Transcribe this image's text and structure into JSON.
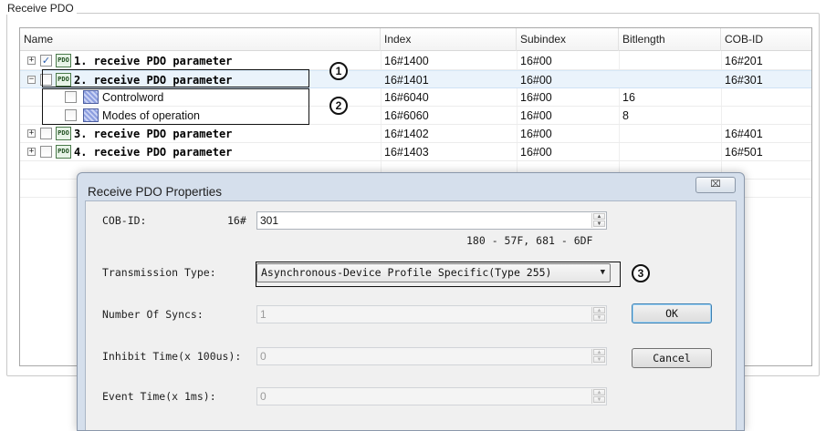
{
  "group": {
    "title": "Receive PDO"
  },
  "columns": {
    "name": "Name",
    "index": "Index",
    "subindex": "Subindex",
    "bitlength": "Bitlength",
    "cobid": "COB-ID"
  },
  "rows": [
    {
      "expander": "+",
      "checked": true,
      "icon": "PDO",
      "name": "1. receive PDO parameter",
      "index": "16#1400",
      "subindex": "16#00",
      "bitlength": "",
      "cobid": "16#201"
    },
    {
      "expander": "−",
      "checked": false,
      "icon": "PDO",
      "name": "2. receive PDO parameter",
      "index": "16#1401",
      "subindex": "16#00",
      "bitlength": "",
      "cobid": "16#301"
    },
    {
      "name": "Controlword",
      "checked": false,
      "index": "16#6040",
      "subindex": "16#00",
      "bitlength": "16",
      "cobid": ""
    },
    {
      "name": "Modes of operation",
      "checked": false,
      "index": "16#6060",
      "subindex": "16#00",
      "bitlength": "8",
      "cobid": ""
    },
    {
      "expander": "+",
      "checked": false,
      "icon": "PDO",
      "name": "3. receive PDO parameter",
      "index": "16#1402",
      "subindex": "16#00",
      "bitlength": "",
      "cobid": "16#401"
    },
    {
      "expander": "+",
      "checked": false,
      "icon": "PDO",
      "name": "4. receive PDO parameter",
      "index": "16#1403",
      "subindex": "16#00",
      "bitlength": "",
      "cobid": "16#501"
    }
  ],
  "callouts": [
    "1",
    "2",
    "3"
  ],
  "dialog": {
    "title": "Receive PDO Properties",
    "close": "⌧",
    "cobid_label": "COB-ID:",
    "cobid_prefix": "16#",
    "cobid_value": "301",
    "cobid_range": "180 - 57F, 681 - 6DF",
    "transmission_label": "Transmission Type:",
    "transmission_value": "Asynchronous-Device Profile Specific(Type 255)",
    "syncs_label": "Number Of Syncs:",
    "syncs_value": "1",
    "inhibit_label": "Inhibit Time(x 100us):",
    "inhibit_value": "0",
    "event_label": "Event Time(x 1ms):",
    "event_value": "0",
    "ok": "OK",
    "cancel": "Cancel"
  },
  "icons": {
    "spin_up": "▲",
    "spin_down": "▼",
    "dropdown": "▼",
    "check": "✓"
  }
}
